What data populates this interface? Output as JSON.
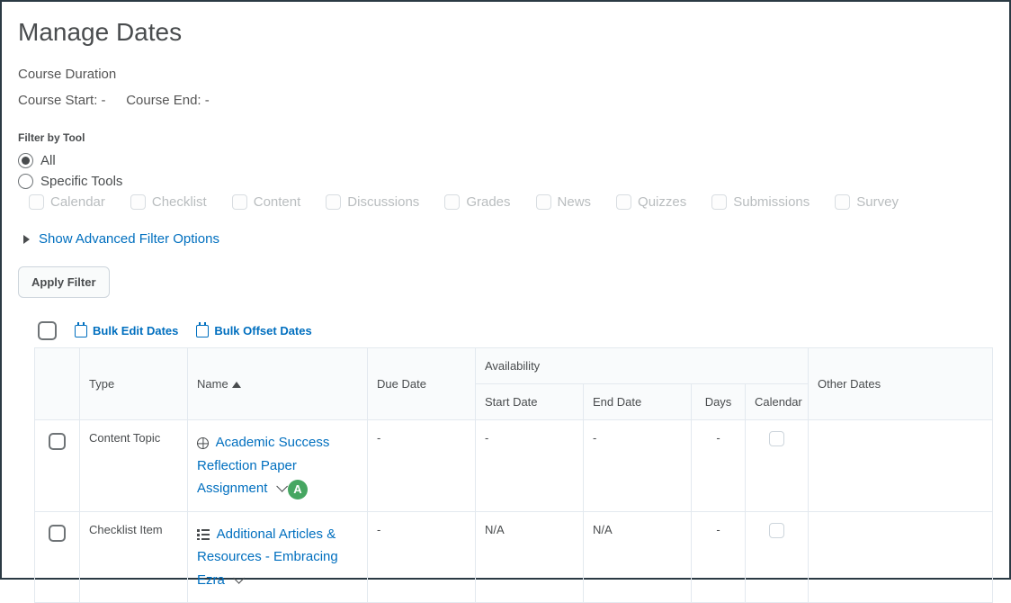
{
  "page": {
    "title": "Manage Dates"
  },
  "duration": {
    "label": "Course Duration",
    "start_label": "Course Start:",
    "start_value": "-",
    "end_label": "Course End:",
    "end_value": "-"
  },
  "filter": {
    "heading": "Filter by Tool",
    "all_label": "All",
    "specific_label": "Specific Tools",
    "tools": [
      "Calendar",
      "Checklist",
      "Content",
      "Discussions",
      "Grades",
      "News",
      "Quizzes",
      "Submissions",
      "Survey"
    ],
    "advanced_label": "Show Advanced Filter Options",
    "apply_label": "Apply Filter"
  },
  "bulk": {
    "edit_label": "Bulk Edit Dates",
    "offset_label": "Bulk Offset Dates"
  },
  "table": {
    "headers": {
      "type": "Type",
      "name": "Name",
      "due": "Due Date",
      "availability": "Availability",
      "start": "Start Date",
      "end": "End Date",
      "days": "Days",
      "calendar": "Calendar",
      "other": "Other Dates"
    },
    "rows": [
      {
        "type": "Content Topic",
        "name": "Academic Success Reflection Paper Assignment",
        "badge": "A",
        "icon": "globe",
        "due": "-",
        "start": "-",
        "end": "-",
        "days": "-"
      },
      {
        "type": "Checklist Item",
        "name": "Additional Articles & Resources - Embracing Ezra",
        "icon": "list",
        "due": "-",
        "start": "N/A",
        "end": "N/A",
        "days": "-"
      }
    ]
  }
}
